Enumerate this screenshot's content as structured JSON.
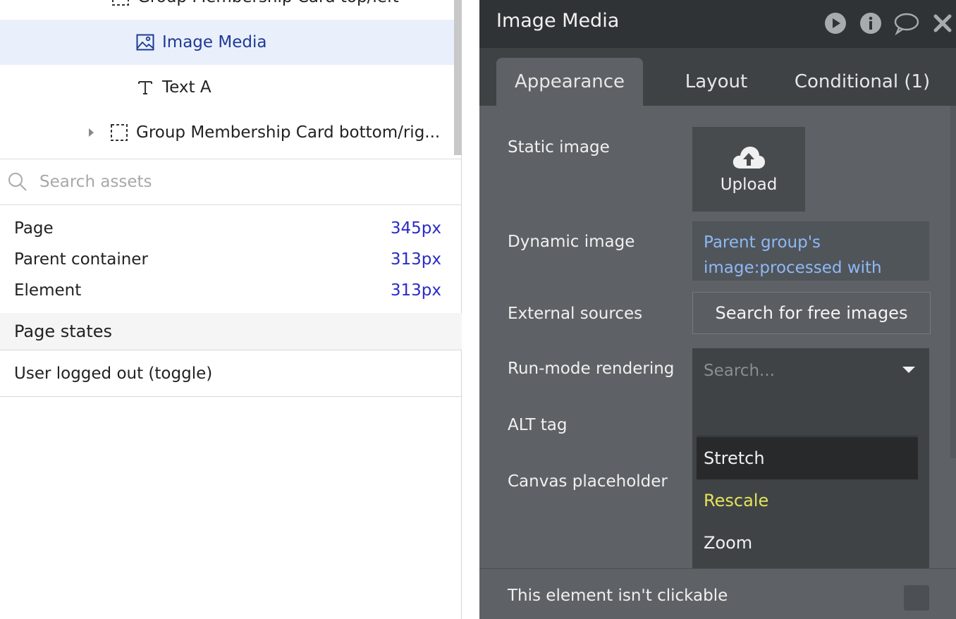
{
  "tree": {
    "items": [
      {
        "label": "Group Membership Card top/left",
        "type": "group"
      },
      {
        "label": "Image Media",
        "type": "image",
        "selected": true
      },
      {
        "label": "Text A",
        "type": "text"
      },
      {
        "label": "Group Membership Card bottom/rig...",
        "type": "group",
        "collapsed": true
      }
    ]
  },
  "search": {
    "placeholder": "Search assets"
  },
  "dimensions": [
    {
      "label": "Page",
      "value": "345px"
    },
    {
      "label": "Parent container",
      "value": "313px"
    },
    {
      "label": "Element",
      "value": "313px"
    }
  ],
  "page_states": {
    "heading": "Page states",
    "items": [
      {
        "label": "User logged out (toggle)"
      }
    ]
  },
  "inspector": {
    "title": "Image Media",
    "tabs": [
      {
        "label": "Appearance",
        "active": true
      },
      {
        "label": "Layout"
      },
      {
        "label": "Conditional (1)"
      }
    ],
    "labels": {
      "static_image": "Static image",
      "dynamic_image": "Dynamic image",
      "external_sources": "External sources",
      "run_mode": "Run-mode rendering",
      "alt_tag": "ALT tag",
      "canvas_placeholder": "Canvas placeholder",
      "not_clickable": "This element isn't clickable"
    },
    "upload_label": "Upload",
    "dynamic_value": "Parent group's image:processed with Imgix",
    "external_button": "Search for free images",
    "dropdown": {
      "placeholder": "Search...",
      "options": [
        {
          "label": "Stretch",
          "highlighted": true
        },
        {
          "label": "Rescale",
          "selected": true
        },
        {
          "label": "Zoom"
        }
      ]
    }
  },
  "colors": {
    "selection_bg": "#e9f0fc",
    "link_blue": "#2b2bc7",
    "dynamic_text": "#8fb8f5",
    "selected_option": "#e3e35a",
    "panel_bg": "#5e6266",
    "header_bg": "#303335"
  }
}
